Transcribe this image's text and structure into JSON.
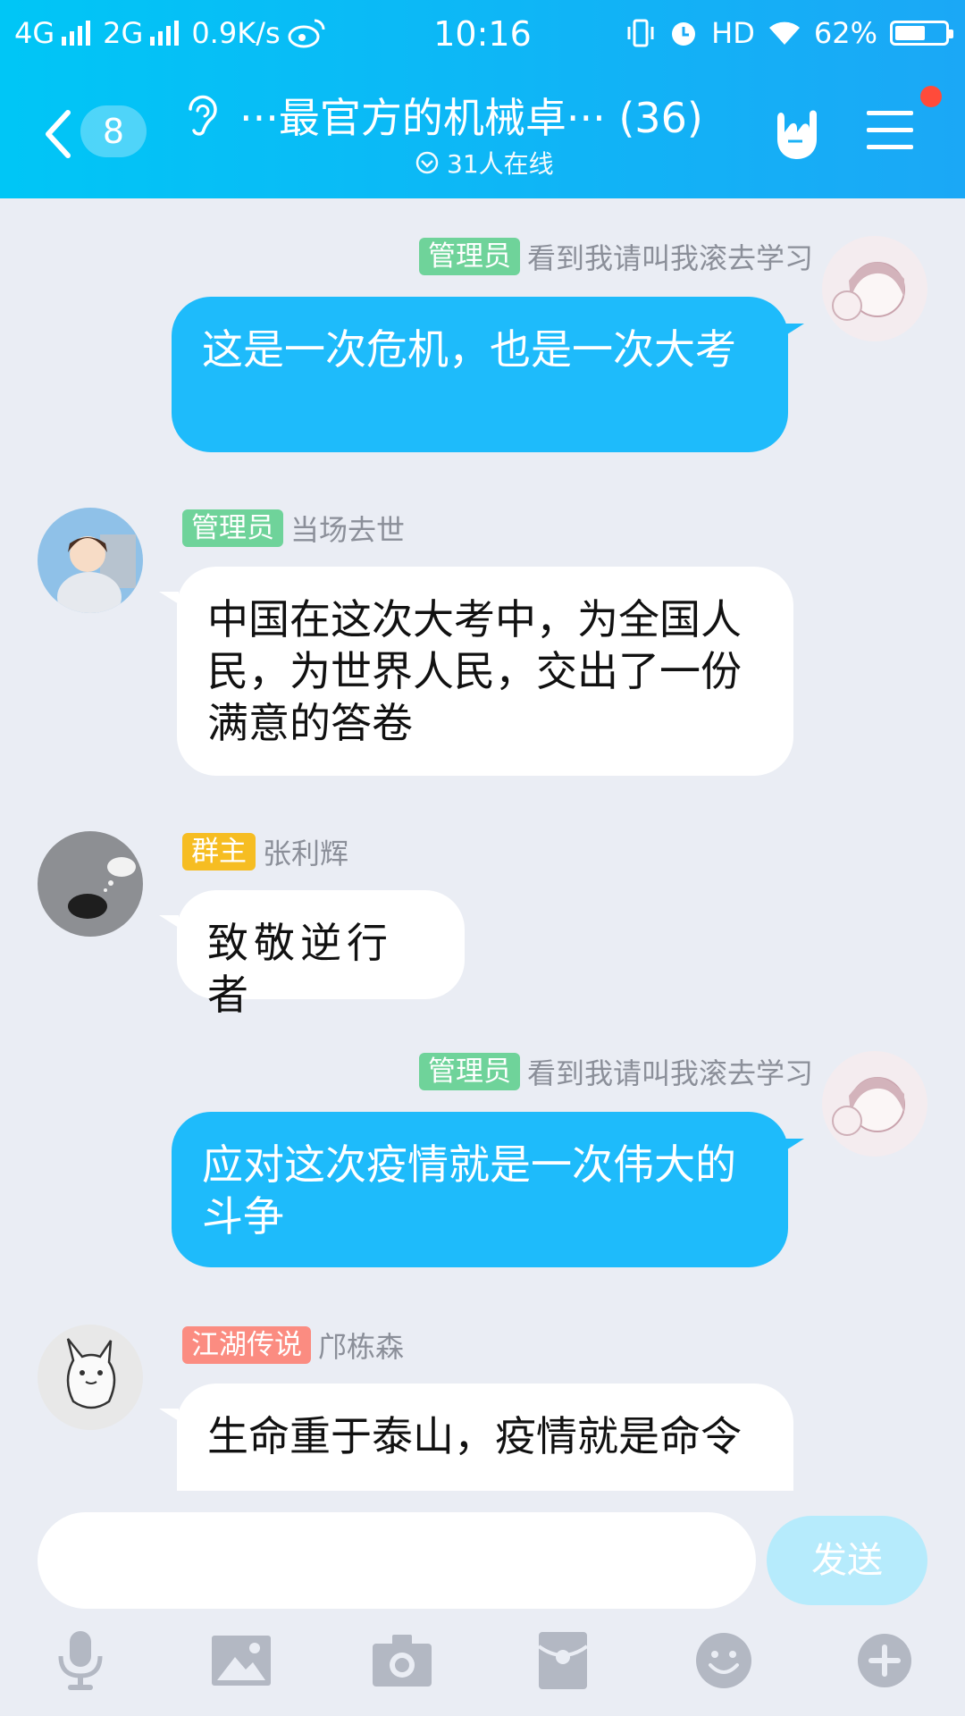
{
  "status_bar": {
    "network1": "4G",
    "network2": "2G",
    "speed": "0.9K/s",
    "time": "10:16",
    "hd": "HD",
    "battery": "62%",
    "battery_level": 0.62
  },
  "nav": {
    "unread_count": "8",
    "title": "···最官方的机械卓··· (36)",
    "online": "31人在线"
  },
  "messages": [
    {
      "side": "right",
      "tag": "管理员",
      "name": "看到我请叫我滚去学习",
      "text": "这是一次危机，也是一次大考"
    },
    {
      "side": "left",
      "tag": "管理员",
      "name": "当场去世",
      "text": "中国在这次大考中，为全国人民，为世界人民，交出了一份满意的答卷"
    },
    {
      "side": "left",
      "tag": "群主",
      "name": "张利辉",
      "text": "致敬逆行者"
    },
    {
      "side": "right",
      "tag": "管理员",
      "name": "看到我请叫我滚去学习",
      "text": "应对这次疫情就是一次伟大的斗争"
    },
    {
      "side": "left",
      "tag": "江湖传说",
      "name": "邝栋森",
      "text": "生命重于泰山，疫情就是命令"
    }
  ],
  "input": {
    "placeholder": "",
    "send_label": "发送"
  },
  "toolbar": {
    "icons": [
      "microphone-icon",
      "image-icon",
      "camera-icon",
      "red-packet-icon",
      "emoji-icon",
      "plus-icon"
    ]
  },
  "colors": {
    "header_start": "#00c6f6",
    "header_end": "#1ba8f6",
    "bubble_right": "#1ebbfb",
    "tag_admin": "#6fd39a",
    "tag_owner": "#f6bd22",
    "tag_legend": "#fb8c81"
  }
}
